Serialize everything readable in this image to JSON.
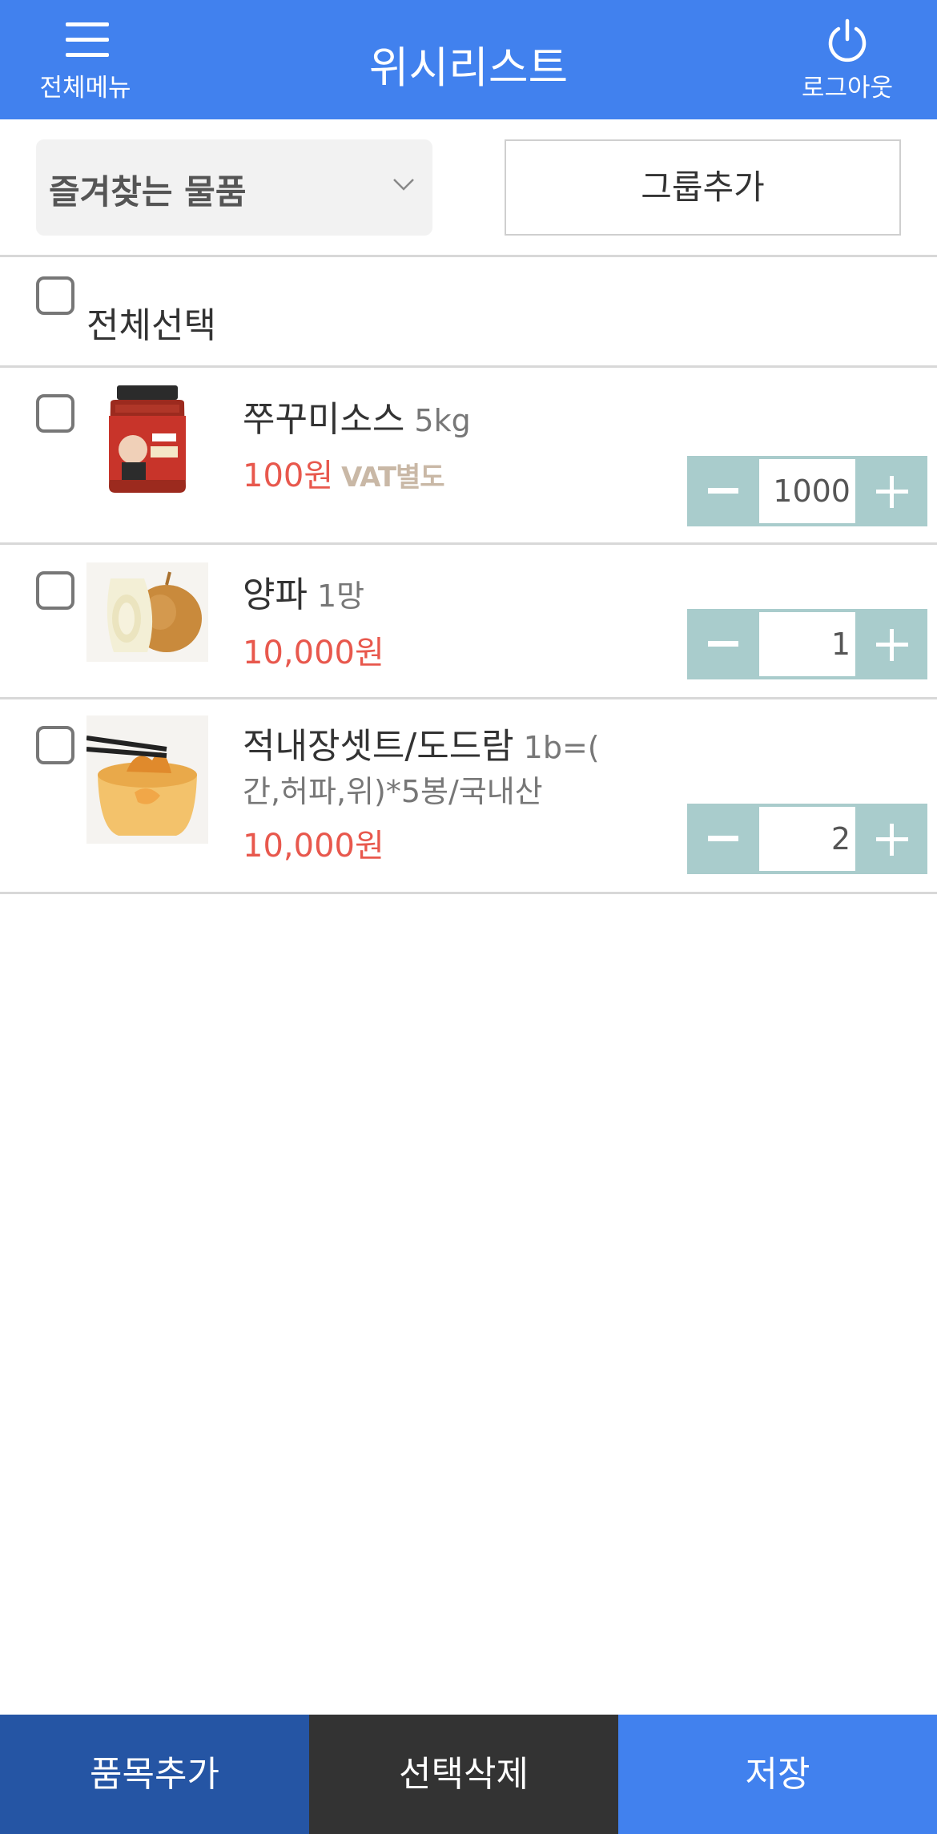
{
  "header": {
    "menu_label": "전체메뉴",
    "title": "위시리스트",
    "logout_label": "로그아웃"
  },
  "toolbar": {
    "group_select": "즐겨찾는 물품",
    "group_add": "그룹추가"
  },
  "select_all_label": "전체선택",
  "items": [
    {
      "name": "쭈꾸미소스",
      "spec": "5kg",
      "price": "100원",
      "vat": "VAT별도",
      "quantity": "1000",
      "image": "sauce-jar-image"
    },
    {
      "name": "양파",
      "spec": "1망",
      "price": "10,000원",
      "quantity": "1",
      "image": "onion-image"
    },
    {
      "name": "적내장셋트/도드람",
      "spec": "1b=(",
      "spec_line2": "간,허파,위)*5봉/국내산",
      "price": "10,000원",
      "quantity": "2",
      "image": "tripe-set-image"
    }
  ],
  "bottom": {
    "add_label": "품목추가",
    "delete_label": "선택삭제",
    "save_label": "저장"
  },
  "colors": {
    "header_bg": "#4181ee",
    "price": "#e8584d",
    "stepper": "#a9cccc",
    "add_bg": "#2555a4",
    "delete_bg": "#333333",
    "save_bg": "#4181ee"
  }
}
